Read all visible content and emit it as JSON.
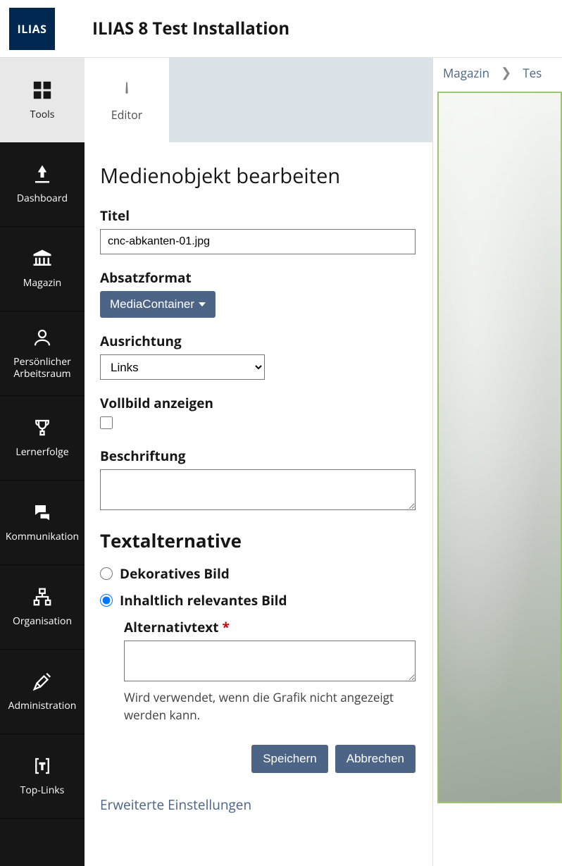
{
  "header": {
    "logo_text": "ILIAS",
    "app_title": "ILIAS 8 Test Installation"
  },
  "sidebar": {
    "tools": {
      "label": "Tools"
    },
    "items": [
      {
        "label": "Dashboard"
      },
      {
        "label": "Magazin"
      },
      {
        "label": "Persönlicher Arbeitsraum"
      },
      {
        "label": "Lernerfolge"
      },
      {
        "label": "Kommunikation"
      },
      {
        "label": "Organisation"
      },
      {
        "label": "Administration"
      },
      {
        "label": "Top-Links"
      }
    ]
  },
  "tool_tab": {
    "editor": "Editor"
  },
  "form": {
    "title": "Medienobjekt bearbeiten",
    "titel_label": "Titel",
    "titel_value": "cnc-abkanten-01.jpg",
    "format_label": "Absatzformat",
    "format_value": "MediaContainer",
    "orientation_label": "Ausrichtung",
    "orientation_value": "Links",
    "fullscreen_label": "Vollbild anzeigen",
    "caption_label": "Beschriftung",
    "caption_value": "",
    "textalt_section": "Textalternative",
    "radio_decorative": "Dekoratives Bild",
    "radio_relevant": "Inhaltlich relevantes Bild",
    "alttext_label": "Alternativtext",
    "alttext_value": "",
    "alttext_help": "Wird verwendet, wenn die Grafik nicht angezeigt werden kann.",
    "save": "Speichern",
    "cancel": "Abbrechen",
    "advanced_link": "Erweiterte Einstellungen"
  },
  "breadcrumb": {
    "item1": "Magazin",
    "item2": "Tes"
  },
  "colors": {
    "primary": "#4c6586",
    "sidebar_bg": "#161616",
    "logo_bg": "#002850"
  }
}
